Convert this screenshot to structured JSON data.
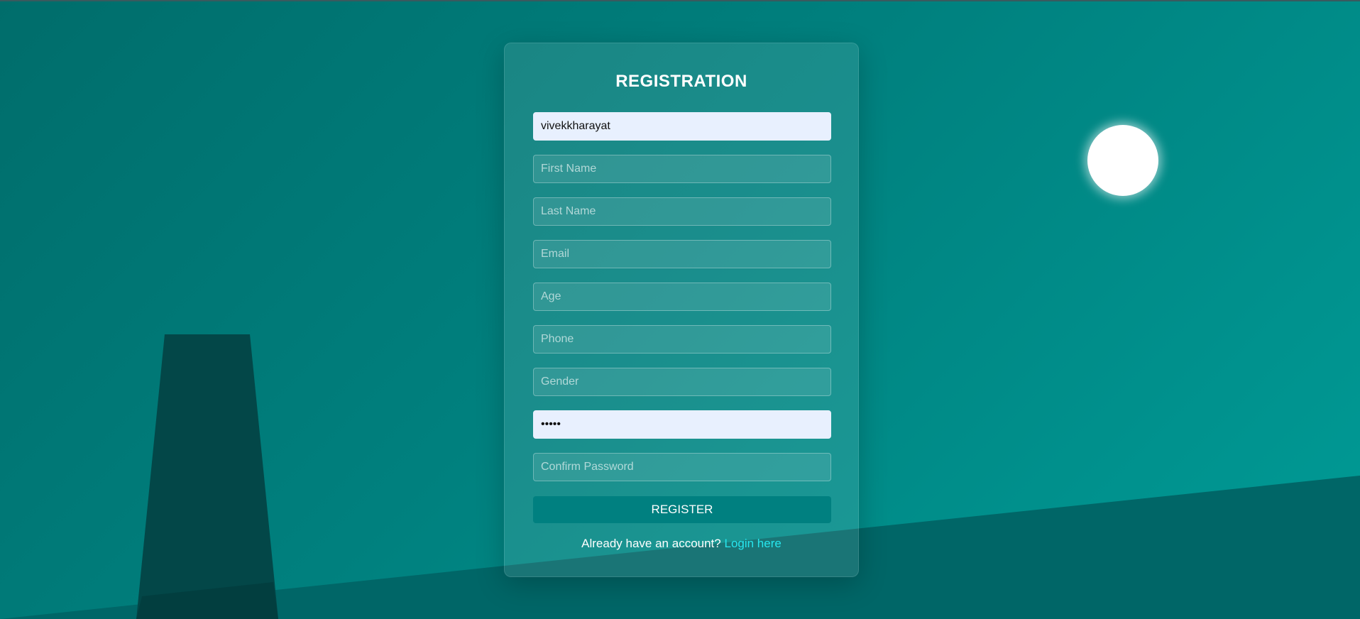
{
  "background": {
    "gradient_start": "#006d6b",
    "gradient_end": "#009b96",
    "hill_color": "#006667",
    "tower_color": "#034748",
    "moon_color": "#ffffff"
  },
  "form": {
    "title": "REGISTRATION",
    "fields": [
      {
        "name": "username",
        "value": "vivekkharayat",
        "placeholder": ""
      },
      {
        "name": "first-name",
        "value": "",
        "placeholder": "First Name"
      },
      {
        "name": "last-name",
        "value": "",
        "placeholder": "Last Name"
      },
      {
        "name": "email",
        "value": "",
        "placeholder": "Email"
      },
      {
        "name": "age",
        "value": "",
        "placeholder": "Age"
      },
      {
        "name": "phone",
        "value": "",
        "placeholder": "Phone"
      },
      {
        "name": "gender",
        "value": "",
        "placeholder": "Gender"
      },
      {
        "name": "password",
        "value": "•••••",
        "placeholder": ""
      },
      {
        "name": "confirm-password",
        "value": "",
        "placeholder": "Confirm Password"
      }
    ],
    "register_label": "REGISTER",
    "footer_text": "Already have an account?",
    "login_link": "Login here",
    "accent_color": "#008080",
    "link_color": "#27e6ee"
  }
}
